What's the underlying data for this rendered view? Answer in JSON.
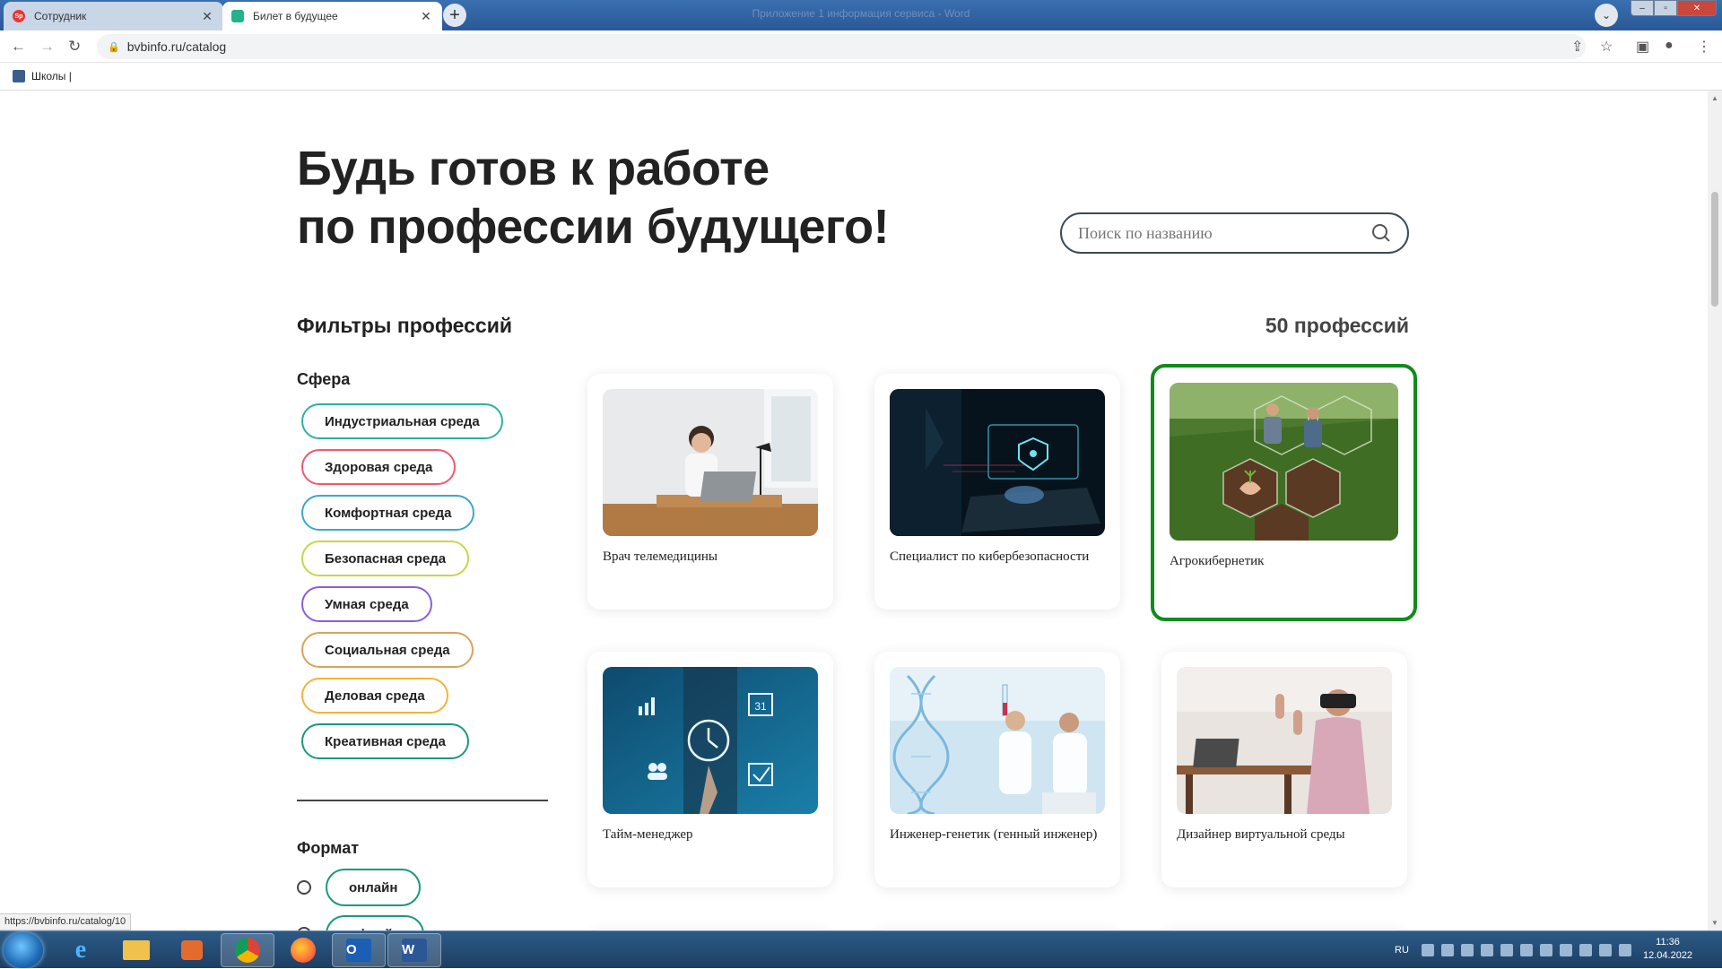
{
  "browser": {
    "tabs": [
      {
        "label": "Сотрудник",
        "icon": "favicon-red-circle-icon"
      },
      {
        "label": "Билет в будущее",
        "icon": "favicon-green-icon"
      }
    ],
    "window_title": "Приложение 1 информация сервиса - Word",
    "url": "bvbinfo.ru/catalog",
    "bookmark": "Школы |",
    "status_url": "https://bvbinfo.ru/catalog/10"
  },
  "page": {
    "hero_line1": "Будь готов к работе",
    "hero_line2": "по профессии будущего!",
    "search_placeholder": "Поиск по названию",
    "filters_title": "Фильтры профессий",
    "count": "50 профессий",
    "sphere_label": "Сфера",
    "spheres": [
      {
        "label": "Индустриальная среда",
        "color": "#2bb3a0"
      },
      {
        "label": "Здоровая среда",
        "color": "#ef5a6f"
      },
      {
        "label": "Комфортная среда",
        "color": "#3aa9c7"
      },
      {
        "label": "Безопасная среда",
        "color": "#c7d64a"
      },
      {
        "label": "Умная среда",
        "color": "#8a5fd8"
      },
      {
        "label": "Социальная среда",
        "color": "#d9a35c"
      },
      {
        "label": "Деловая среда",
        "color": "#f2b43a"
      },
      {
        "label": "Креативная среда",
        "color": "#1a9a7a"
      }
    ],
    "format_label": "Формат",
    "formats": [
      "онлайн",
      "офлайн"
    ],
    "cards": [
      {
        "title": "Врач телемедицины",
        "selected": false
      },
      {
        "title": "Специалист по кибербезопасности",
        "selected": false
      },
      {
        "title": "Агрокибернетик",
        "selected": true
      },
      {
        "title": "Тайм-менеджер",
        "selected": false
      },
      {
        "title": "Инженер-генетик (генный инженер)",
        "selected": false
      },
      {
        "title": "Дизайнер виртуальной среды",
        "selected": false
      }
    ]
  },
  "taskbar": {
    "lang": "RU",
    "time": "11:36",
    "date": "12.04.2022"
  },
  "colors": {
    "accent": "#118c1c",
    "taskbar": "#1d3f63"
  }
}
